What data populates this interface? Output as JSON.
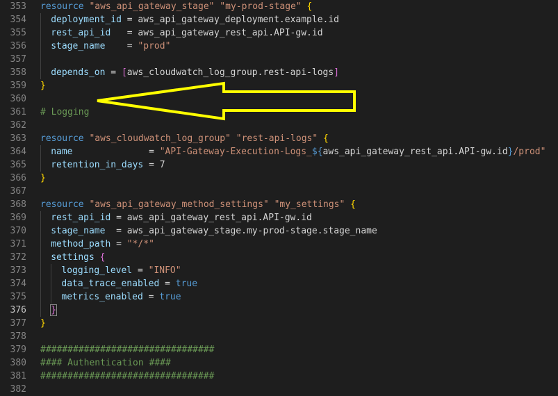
{
  "colors": {
    "background": "#1e1e1e",
    "gutter": "#858585",
    "keyword": "#569cd6",
    "string": "#ce9178",
    "attribute": "#9cdcfe",
    "comment": "#6a9955",
    "arrow": "#ffff00"
  },
  "editor": {
    "current_line": "376",
    "lines": [
      {
        "num": "353",
        "indent": 0,
        "tokens": [
          [
            "kw",
            "resource "
          ],
          [
            "str",
            "\"aws_api_gateway_stage\""
          ],
          [
            "plain",
            " "
          ],
          [
            "str",
            "\"my-prod-stage\""
          ],
          [
            "plain",
            " "
          ],
          [
            "b1",
            "{"
          ]
        ]
      },
      {
        "num": "354",
        "indent": 1,
        "tokens": [
          [
            "attr",
            "deployment_id"
          ],
          [
            "plain",
            " = aws_api_gateway_deployment.example.id"
          ]
        ]
      },
      {
        "num": "355",
        "indent": 1,
        "tokens": [
          [
            "attr",
            "rest_api_id"
          ],
          [
            "plain",
            "   = aws_api_gateway_rest_api.API-gw.id"
          ]
        ]
      },
      {
        "num": "356",
        "indent": 1,
        "tokens": [
          [
            "attr",
            "stage_name"
          ],
          [
            "plain",
            "    = "
          ],
          [
            "str",
            "\"prod\""
          ]
        ]
      },
      {
        "num": "357",
        "indent": 1,
        "tokens": []
      },
      {
        "num": "358",
        "indent": 1,
        "tokens": [
          [
            "attr",
            "depends_on"
          ],
          [
            "plain",
            " = "
          ],
          [
            "b2",
            "["
          ],
          [
            "plain",
            "aws_cloudwatch_log_group.rest-api-logs"
          ],
          [
            "b2",
            "]"
          ]
        ]
      },
      {
        "num": "359",
        "indent": 0,
        "tokens": [
          [
            "b1",
            "}"
          ]
        ]
      },
      {
        "num": "360",
        "indent": 0,
        "tokens": []
      },
      {
        "num": "361",
        "indent": 0,
        "tokens": [
          [
            "com",
            "# Logging"
          ]
        ]
      },
      {
        "num": "362",
        "indent": 0,
        "tokens": []
      },
      {
        "num": "363",
        "indent": 0,
        "tokens": [
          [
            "kw",
            "resource "
          ],
          [
            "str",
            "\"aws_cloudwatch_log_group\""
          ],
          [
            "plain",
            " "
          ],
          [
            "str",
            "\"rest-api-logs\""
          ],
          [
            "plain",
            " "
          ],
          [
            "b1",
            "{"
          ]
        ]
      },
      {
        "num": "364",
        "indent": 1,
        "tokens": [
          [
            "attr",
            "name"
          ],
          [
            "plain",
            "              = "
          ],
          [
            "str",
            "\"API-Gateway-Execution-Logs_"
          ],
          [
            "interp",
            "${"
          ],
          [
            "plain",
            "aws_api_gateway_rest_api.API-gw.id"
          ],
          [
            "interp",
            "}"
          ],
          [
            "str",
            "/prod\""
          ]
        ]
      },
      {
        "num": "365",
        "indent": 1,
        "tokens": [
          [
            "attr",
            "retention_in_days"
          ],
          [
            "plain",
            " = 7"
          ]
        ]
      },
      {
        "num": "366",
        "indent": 0,
        "tokens": [
          [
            "b1",
            "}"
          ]
        ]
      },
      {
        "num": "367",
        "indent": 0,
        "tokens": []
      },
      {
        "num": "368",
        "indent": 0,
        "tokens": [
          [
            "kw",
            "resource "
          ],
          [
            "str",
            "\"aws_api_gateway_method_settings\""
          ],
          [
            "plain",
            " "
          ],
          [
            "str",
            "\"my_settings\""
          ],
          [
            "plain",
            " "
          ],
          [
            "b1",
            "{"
          ]
        ]
      },
      {
        "num": "369",
        "indent": 1,
        "tokens": [
          [
            "attr",
            "rest_api_id"
          ],
          [
            "plain",
            " = aws_api_gateway_rest_api.API-gw.id"
          ]
        ]
      },
      {
        "num": "370",
        "indent": 1,
        "tokens": [
          [
            "attr",
            "stage_name"
          ],
          [
            "plain",
            "  = aws_api_gateway_stage.my-prod-stage.stage_name"
          ]
        ]
      },
      {
        "num": "371",
        "indent": 1,
        "tokens": [
          [
            "attr",
            "method_path"
          ],
          [
            "plain",
            " = "
          ],
          [
            "str",
            "\"*/*\""
          ]
        ]
      },
      {
        "num": "372",
        "indent": 1,
        "tokens": [
          [
            "attr",
            "settings"
          ],
          [
            "plain",
            " "
          ],
          [
            "b2",
            "{"
          ]
        ]
      },
      {
        "num": "373",
        "indent": 2,
        "tokens": [
          [
            "attr",
            "logging_level"
          ],
          [
            "plain",
            " = "
          ],
          [
            "str",
            "\"INFO\""
          ]
        ]
      },
      {
        "num": "374",
        "indent": 2,
        "tokens": [
          [
            "attr",
            "data_trace_enabled"
          ],
          [
            "plain",
            " = "
          ],
          [
            "bool",
            "true"
          ]
        ]
      },
      {
        "num": "375",
        "indent": 2,
        "tokens": [
          [
            "attr",
            "metrics_enabled"
          ],
          [
            "plain",
            " = "
          ],
          [
            "bool",
            "true"
          ]
        ]
      },
      {
        "num": "376",
        "indent": 1,
        "tokens": [
          [
            "b2m",
            "}"
          ]
        ]
      },
      {
        "num": "377",
        "indent": 0,
        "tokens": [
          [
            "b1",
            "}"
          ]
        ]
      },
      {
        "num": "378",
        "indent": 0,
        "tokens": []
      },
      {
        "num": "379",
        "indent": 0,
        "tokens": [
          [
            "com",
            "################################"
          ]
        ]
      },
      {
        "num": "380",
        "indent": 0,
        "tokens": [
          [
            "com",
            "#### Authentication ####"
          ]
        ]
      },
      {
        "num": "381",
        "indent": 0,
        "tokens": [
          [
            "com",
            "################################"
          ]
        ]
      },
      {
        "num": "382",
        "indent": 0,
        "tokens": []
      }
    ]
  }
}
